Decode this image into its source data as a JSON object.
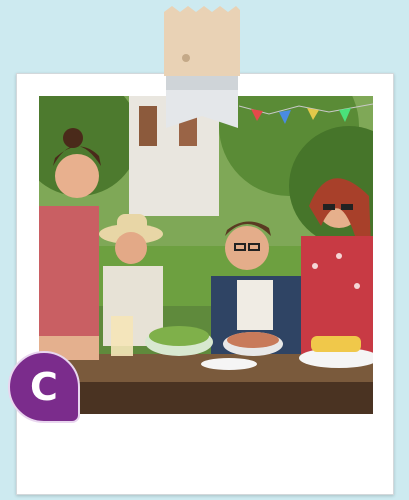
{
  "badge": {
    "letter": "C"
  },
  "colors": {
    "background": "#cdeaf0",
    "frame": "#ffffff",
    "badge": "#7b2c8c",
    "tape": "#e9d2b5"
  },
  "photo": {
    "description_icon": "outdoor-dinner-photo"
  }
}
